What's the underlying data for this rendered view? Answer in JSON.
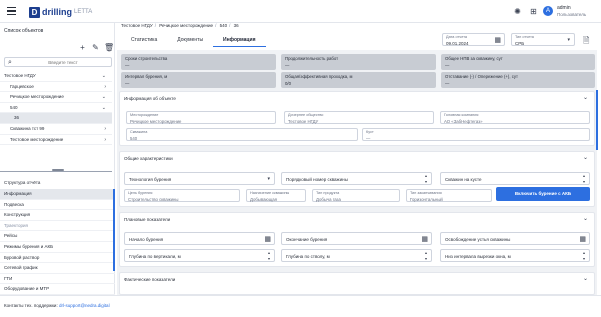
{
  "app": {
    "logo_mark": "D",
    "logo_word": "drilling",
    "logo_sub": "LETTA"
  },
  "user": {
    "avatar_letter": "A",
    "name": "admin",
    "role": "Пользователь"
  },
  "sidebar": {
    "title": "Список объектов",
    "search_placeholder": "Введите текст",
    "tree": [
      {
        "label": "Тестовое НГДУ",
        "indent": 0,
        "chevron": "⌄"
      },
      {
        "label": "Гарцевское",
        "indent": 1,
        "chevron": "›"
      },
      {
        "label": "Речицкое месторождение",
        "indent": 1,
        "chevron": "⌄"
      },
      {
        "label": "540",
        "indent": 2,
        "chevron": "⌄"
      },
      {
        "label": "36",
        "indent": 3,
        "chevron": "",
        "active": true
      },
      {
        "label": "Скважина тст 99",
        "indent": 2,
        "chevron": "›"
      },
      {
        "label": "Тестовое месторождение",
        "indent": 1,
        "chevron": "›"
      }
    ],
    "structure_title": "Структура отчёта",
    "structure": [
      {
        "label": "Информация",
        "state": "active"
      },
      {
        "label": "Подвеска",
        "state": ""
      },
      {
        "label": "Конструкция",
        "state": ""
      },
      {
        "label": "Траектория",
        "state": "muted"
      },
      {
        "label": "Рейсы",
        "state": ""
      },
      {
        "label": "Режимы бурения и АКБ",
        "state": ""
      },
      {
        "label": "Буровой раствор",
        "state": ""
      },
      {
        "label": "Сетевой график",
        "state": ""
      },
      {
        "label": "ГТИ",
        "state": ""
      },
      {
        "label": "Оборудование и МТР",
        "state": ""
      }
    ]
  },
  "footer": {
    "text": "Контакты тех. поддержки:",
    "email": "drl-support@nedra.digital"
  },
  "breadcrumb": [
    "Тестовое НГДУ",
    "Речицкое месторождение",
    "540",
    "36"
  ],
  "tabs": [
    "Статистика",
    "Документы",
    "Информация"
  ],
  "report_date": {
    "label": "Дата отчета",
    "value": "09.01.2024"
  },
  "report_type": {
    "label": "Тип отчета",
    "value": "СРБ"
  },
  "summary_cards": [
    {
      "label": "Сроки строительства",
      "value": "—"
    },
    {
      "label": "Продолжительность работ",
      "value": "—"
    },
    {
      "label": "Общее НПВ за скважину, сут",
      "value": "—"
    },
    {
      "label": "Интервал бурения, м",
      "value": "—"
    },
    {
      "label": "Общая/эффективная проходка, м",
      "value": "0/0"
    },
    {
      "label": "Отставание (-) / Опережение (+), сут",
      "value": "—"
    }
  ],
  "well_info": {
    "title": "Информация об объекте",
    "fields": [
      {
        "label": "Месторождение",
        "value": "Речицкое месторождение"
      },
      {
        "label": "Дочернее общество",
        "value": "Тестовое НГДУ"
      },
      {
        "label": "Головная компания",
        "value": "АО «ЗабНефтегаз»"
      },
      {
        "label": "Скважина",
        "value": "540"
      },
      {
        "label": "Куст",
        "value": "—"
      }
    ]
  },
  "general": {
    "title": "Общие характеристики",
    "tech_label": "Технология бурения",
    "order_label": "Порядковый номер скважины",
    "on_pad_label": "Скважин на кусте",
    "fields": [
      {
        "label": "Цель бурения",
        "value": "Строительство скважины"
      },
      {
        "label": "Назначение скважины",
        "value": "Добывающая"
      },
      {
        "label": "Тип продукта",
        "value": "Добыча газа"
      },
      {
        "label": "Тип заканчивания",
        "value": "Горизонтальный"
      }
    ],
    "button": "Включить бурение с АКБ"
  },
  "plan": {
    "title": "Плановые показатели",
    "start": "Начало бурения",
    "end": "Окончание бурения",
    "release": "Освобождение устья скважины",
    "vertical": "Глубина по вертикали, м",
    "md": "Глубина по стволу, м",
    "bottom": "Низ интервала вырезки окна, м"
  },
  "fact": {
    "title": "Фактические показатели"
  }
}
